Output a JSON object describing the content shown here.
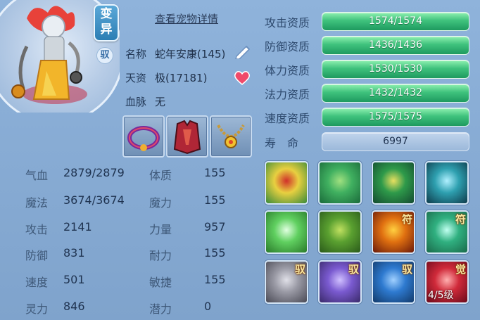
{
  "pet": {
    "transform_badge": "变异",
    "drive_badge": "驭",
    "detail_link": "查看宠物详情",
    "name_label": "名称",
    "name_value": "蛇年安康(145)",
    "aptitude_label": "天资",
    "aptitude_value": "极(17181)",
    "bloodline_label": "血脉",
    "bloodline_value": "无"
  },
  "equipment": [
    {
      "name": "collar-equip"
    },
    {
      "name": "armor-equip"
    },
    {
      "name": "amulet-equip"
    }
  ],
  "stats": [
    {
      "label": "气血",
      "value": "2879/2879"
    },
    {
      "label": "魔法",
      "value": "3674/3674"
    },
    {
      "label": "攻击",
      "value": "2141"
    },
    {
      "label": "防御",
      "value": "831"
    },
    {
      "label": "速度",
      "value": "501"
    },
    {
      "label": "灵力",
      "value": "846"
    }
  ],
  "attributes": [
    {
      "label": "体质",
      "value": "155"
    },
    {
      "label": "魔力",
      "value": "155"
    },
    {
      "label": "力量",
      "value": "957"
    },
    {
      "label": "耐力",
      "value": "155"
    },
    {
      "label": "敏捷",
      "value": "155"
    },
    {
      "label": "潜力",
      "value": "0"
    }
  ],
  "qualities": [
    {
      "label": "攻击资质",
      "value": "1574/1574",
      "fraction": 1.0
    },
    {
      "label": "防御资质",
      "value": "1436/1436",
      "fraction": 1.0
    },
    {
      "label": "体力资质",
      "value": "1530/1530",
      "fraction": 1.0
    },
    {
      "label": "法力资质",
      "value": "1432/1432",
      "fraction": 1.0
    },
    {
      "label": "速度资质",
      "value": "1575/1575",
      "fraction": 1.0
    }
  ],
  "lifespan": {
    "label": "寿　命",
    "value": "6997"
  },
  "skills": [
    {
      "name": "sword-strike-skill",
      "tag": "",
      "level": ""
    },
    {
      "name": "green-spirit-skill",
      "tag": "",
      "level": ""
    },
    {
      "name": "shadow-warrior-skill",
      "tag": "",
      "level": ""
    },
    {
      "name": "blue-flame-skill",
      "tag": "",
      "level": ""
    },
    {
      "name": "light-burst-skill",
      "tag": "",
      "level": ""
    },
    {
      "name": "giant-form-skill",
      "tag": "",
      "level": ""
    },
    {
      "name": "fire-rune-skill",
      "tag": "符",
      "level": ""
    },
    {
      "name": "shield-rune-skill",
      "tag": "符",
      "level": ""
    },
    {
      "name": "fist-skill",
      "tag": "驭",
      "level": ""
    },
    {
      "name": "purple-fist-skill",
      "tag": "驭",
      "level": ""
    },
    {
      "name": "blade-skill",
      "tag": "驭",
      "level": ""
    },
    {
      "name": "awaken-skill",
      "tag": "觉",
      "level": "4/5级"
    }
  ],
  "colors": {
    "panel_bg": "#8fb3db",
    "bar_green": "#3fc27d",
    "text_dark": "#1f3350"
  }
}
